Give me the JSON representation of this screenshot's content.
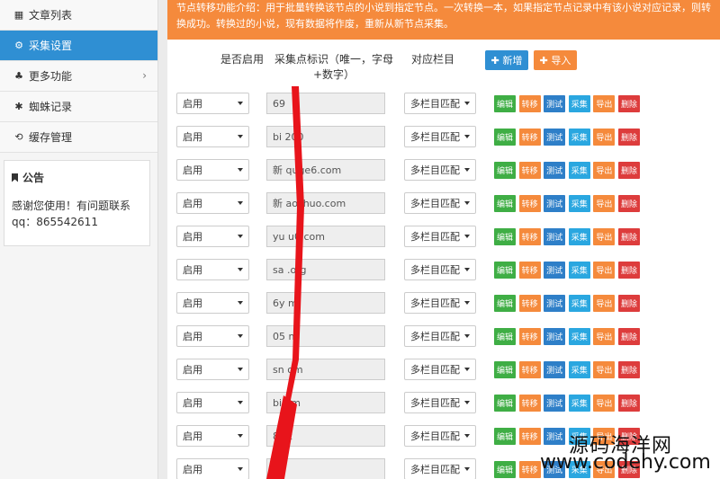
{
  "sidebar": {
    "items": [
      {
        "label": "文章列表",
        "icon": "grid-icon",
        "glyph": "▦",
        "active": false
      },
      {
        "label": "采集设置",
        "icon": "cogs-icon",
        "glyph": "⚙",
        "active": true
      },
      {
        "label": "更多功能",
        "icon": "sitemap-icon",
        "glyph": "♣",
        "active": false,
        "chevron": "›"
      },
      {
        "label": "蜘蛛记录",
        "icon": "bug-icon",
        "glyph": "✱",
        "active": false
      },
      {
        "label": "缓存管理",
        "icon": "refresh-icon",
        "glyph": "⟲",
        "active": false
      }
    ],
    "notice": {
      "title": "公告",
      "text": "感谢您使用！有问题联系qq：865542611"
    }
  },
  "banner": {
    "text": "节点转移功能介绍：用于批量转换该节点的小说到指定节点。一次转换一本，如果指定节点记录中有该小说对应记录，则转换成功。转换过的小说，现有数据将作废，重新从新节点采集。"
  },
  "headers": {
    "enabled": "是否启用",
    "identifier": "采集点标识（唯一，字母+数字）",
    "column": "对应栏目"
  },
  "toolbar": {
    "new_label": "✚ 新增",
    "import_label": "✚ 导入"
  },
  "actions": {
    "edit": "编辑",
    "move": "转移",
    "test": "测试",
    "collect": "采集",
    "export": "导出",
    "delete": "删除"
  },
  "rows": [
    {
      "enabled": "启用",
      "identifier": "69",
      "column": "多栏目匹配"
    },
    {
      "enabled": "启用",
      "identifier": "bi     200",
      "column": "多栏目匹配"
    },
    {
      "enabled": "启用",
      "identifier": "新       quge6.com",
      "column": "多栏目匹配"
    },
    {
      "enabled": "启用",
      "identifier": "新       aoshuo.com",
      "column": "多栏目匹配"
    },
    {
      "enabled": "启用",
      "identifier": "yu       u0.com",
      "column": "多栏目匹配"
    },
    {
      "enabled": "启用",
      "identifier": "sa       .org",
      "column": "多栏目匹配"
    },
    {
      "enabled": "启用",
      "identifier": "6y       m",
      "column": "多栏目匹配"
    },
    {
      "enabled": "启用",
      "identifier": "05       m",
      "column": "多栏目匹配"
    },
    {
      "enabled": "启用",
      "identifier": "sn       om",
      "column": "多栏目匹配"
    },
    {
      "enabled": "启用",
      "identifier": "bi       om",
      "column": "多栏目匹配"
    },
    {
      "enabled": "启用",
      "identifier": "8        et",
      "column": "多栏目匹配"
    },
    {
      "enabled": "启用",
      "identifier": "         et",
      "column": "多栏目匹配"
    }
  ],
  "watermark": {
    "line1": "源码海洋网",
    "line2": "www.codehy.com"
  }
}
